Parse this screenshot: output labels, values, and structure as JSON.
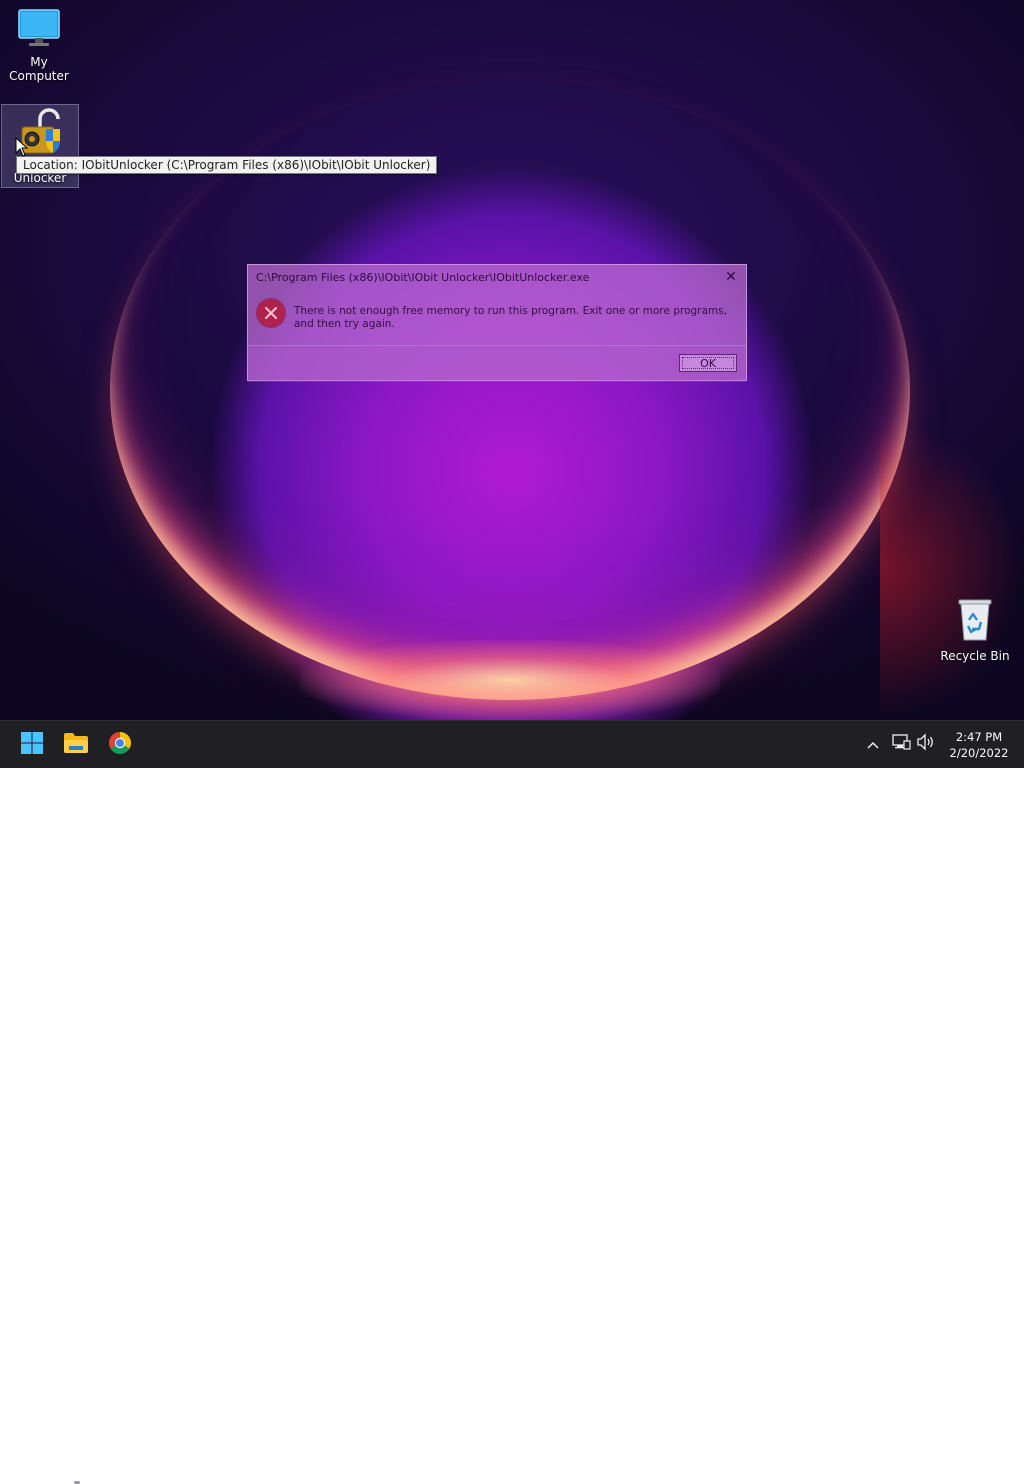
{
  "desktop": {
    "icons": [
      {
        "label": "My Computer",
        "icon": "monitor-icon"
      },
      {
        "label": "Unlocker",
        "icon": "unlocker-icon"
      },
      {
        "label": "Recycle Bin",
        "icon": "recycle-bin-icon"
      }
    ],
    "tooltip": "Location: IObitUnlocker (C:\\Program Files (x86)\\IObit\\IObit Unlocker)"
  },
  "dialog": {
    "title": "C:\\Program Files (x86)\\IObit\\IObit Unlocker\\IObitUnlocker.exe",
    "close_label": "✕",
    "message": "There is not enough free memory to run this program. Exit one or more programs, and then try again.",
    "ok_label": "OK",
    "icon": "error-icon"
  },
  "taskbar": {
    "apps": [
      {
        "name": "Start",
        "icon": "windows-start-icon"
      },
      {
        "name": "File Explorer",
        "icon": "folder-icon"
      },
      {
        "name": "Google Chrome",
        "icon": "chrome-icon"
      }
    ],
    "tray": {
      "icons": [
        "chevron-up-icon",
        "network-icon",
        "volume-icon"
      ]
    },
    "clock": {
      "time": "2:47 PM",
      "date": "2/20/2022"
    }
  },
  "colors": {
    "taskbar_bg": "#1f1f24",
    "dialog_bg": "#be6ed2",
    "error_red": "#b0224e",
    "wallpaper_accent": "#b01ad0"
  }
}
